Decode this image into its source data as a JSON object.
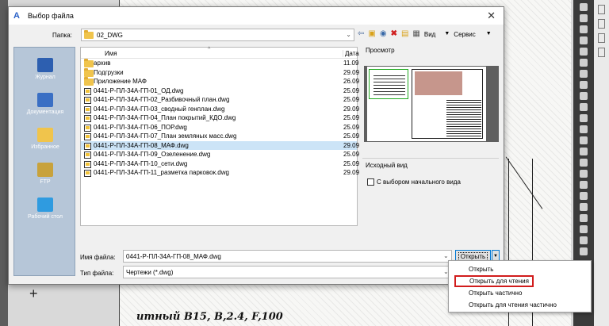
{
  "window": {
    "title": "Выбор файла"
  },
  "toolbar": {
    "folder_label": "Папка:",
    "folder_value": "02_DWG",
    "view_label": "Вид",
    "service_label": "Сервис"
  },
  "places": [
    {
      "label": "Журнал",
      "icon": "history-icon",
      "color": "#2d5fb0"
    },
    {
      "label": "Документация",
      "icon": "documents-icon",
      "color": "#3a6fc4"
    },
    {
      "label": "Избранное",
      "icon": "favorites-folder-icon",
      "color": "#f0c44c"
    },
    {
      "label": "FTP",
      "icon": "ftp-icon",
      "color": "#c8a23c"
    },
    {
      "label": "Рабочий стол",
      "icon": "desktop-icon",
      "color": "#2f9be0"
    }
  ],
  "filelist": {
    "col_name": "Имя",
    "col_date": "Дата",
    "rows": [
      {
        "name": "архив",
        "date": "11.09",
        "type": "folder"
      },
      {
        "name": "Подгрузки",
        "date": "29.09",
        "type": "folder"
      },
      {
        "name": "Приложение МАФ",
        "date": "26.09",
        "type": "folder"
      },
      {
        "name": "0441-Р-ПЛ-34А-ГП-01_ОД.dwg",
        "date": "25.09",
        "type": "dwg"
      },
      {
        "name": "0441-Р-ПЛ-34А-ГП-02_Разбивочный план.dwg",
        "date": "25.09",
        "type": "dwg"
      },
      {
        "name": "0441-Р-ПЛ-34А-ГП-03_сводный генплан.dwg",
        "date": "29.09",
        "type": "dwg"
      },
      {
        "name": "0441-Р-ПЛ-34А-ГП-04_План покрытий_КДО.dwg",
        "date": "25.09",
        "type": "dwg"
      },
      {
        "name": "0441-Р-ПЛ-34А-ГП-06_ПОР.dwg",
        "date": "25.09",
        "type": "dwg"
      },
      {
        "name": "0441-Р-ПЛ-34А-ГП-07_План земляных масс.dwg",
        "date": "25.09",
        "type": "dwg"
      },
      {
        "name": "0441-Р-ПЛ-34А-ГП-08_МАФ.dwg",
        "date": "29.09",
        "type": "dwg",
        "selected": true
      },
      {
        "name": "0441-Р-ПЛ-34А-ГП-09_Озеленение.dwg",
        "date": "25.09",
        "type": "dwg"
      },
      {
        "name": "0441-Р-ПЛ-34А-ГП-10_сети.dwg",
        "date": "25.09",
        "type": "dwg"
      },
      {
        "name": "0441-Р-ПЛ-34А-ГП-11_разметка парковок.dwg",
        "date": "29.09",
        "type": "dwg"
      }
    ]
  },
  "preview": {
    "label": "Просмотр"
  },
  "initial_view": {
    "label": "Исходный вид",
    "checkbox_label": "С выбором начального вида",
    "checked": false
  },
  "filename": {
    "label": "Имя файла:",
    "value": "0441-Р-ПЛ-34А-ГП-08_МАФ.dwg"
  },
  "filetype": {
    "label": "Тип файла:",
    "value": "Чертежи (*.dwg)"
  },
  "open_button": {
    "label": "Открыть"
  },
  "open_menu": {
    "items": [
      "Открыть",
      "Открыть для чтения",
      "Открыть частично",
      "Открыть для чтения частично"
    ],
    "highlighted_index": 1
  },
  "background": {
    "drawing_text": "итный B15, B,2.4, F,100"
  },
  "colors": {
    "selection": "#cce4f7",
    "highlight_border": "#d11c1c",
    "accent": "#0078d4"
  }
}
